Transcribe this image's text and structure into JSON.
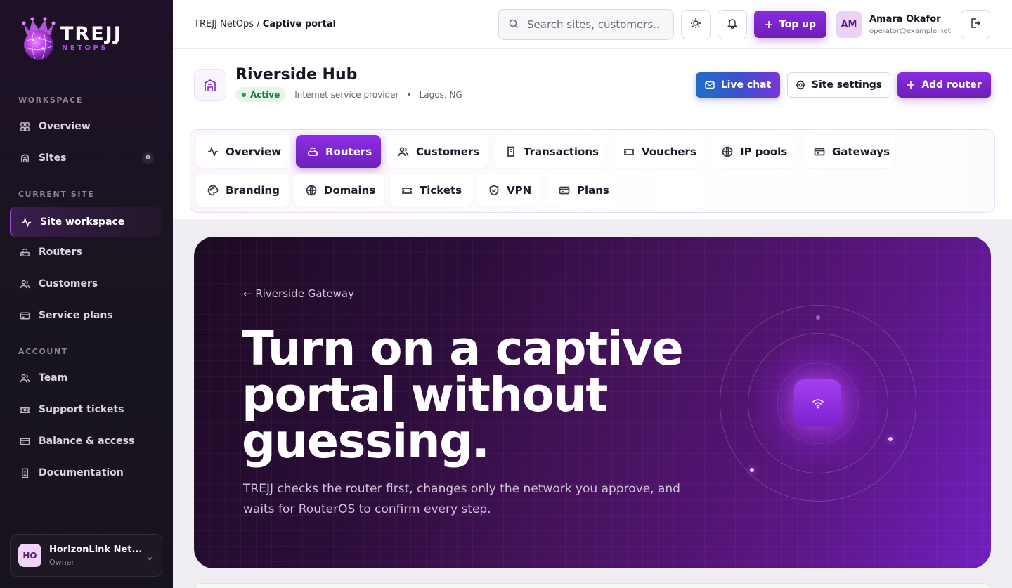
{
  "brand": {
    "title": "TREJJ",
    "subtitle": "NETOPS",
    "accent": "#7c22ce"
  },
  "sidebar": {
    "sections": {
      "workspace": "WORKSPACE",
      "current_site": "CURRENT SITE",
      "account": "ACCOUNT"
    },
    "items": [
      {
        "label": "Overview",
        "icon": "grid-icon"
      },
      {
        "label": "Sites",
        "icon": "building-icon",
        "badge": "0"
      },
      {
        "label": "Site workspace",
        "icon": "activity-icon",
        "active": true
      },
      {
        "label": "Routers",
        "icon": "router-icon"
      },
      {
        "label": "Customers",
        "icon": "users-icon"
      },
      {
        "label": "Service plans",
        "icon": "card-icon"
      },
      {
        "label": "Team",
        "icon": "users-icon"
      },
      {
        "label": "Support tickets",
        "icon": "ticket-icon"
      },
      {
        "label": "Balance & access",
        "icon": "card-icon"
      },
      {
        "label": "Documentation",
        "icon": "doc-icon"
      }
    ],
    "org": {
      "initials": "HO",
      "name": "HorizonLink Net...",
      "role": "Owner"
    }
  },
  "topbar": {
    "breadcrumb_root": "TREJJ NetOps",
    "breadcrumb_sep": "/",
    "breadcrumb_current": "Captive portal",
    "search_placeholder": "Search sites, customers...",
    "topup_label": "Top up",
    "user": {
      "initials": "AM",
      "name": "Amara Okafor",
      "email": "operator@example.net"
    }
  },
  "site": {
    "name": "Riverside Hub",
    "status": "Active",
    "type": "Internet service provider",
    "dot": "•",
    "location": "Lagos, NG",
    "buttons": {
      "live_chat": "Live chat",
      "settings": "Site settings",
      "add_router": "Add router"
    }
  },
  "tabs": [
    {
      "label": "Overview",
      "icon": "activity-icon"
    },
    {
      "label": "Routers",
      "icon": "router-icon",
      "active": true
    },
    {
      "label": "Customers",
      "icon": "users-icon"
    },
    {
      "label": "Transactions",
      "icon": "receipt-icon"
    },
    {
      "label": "Vouchers",
      "icon": "ticket-icon"
    },
    {
      "label": "IP pools",
      "icon": "globe-icon"
    },
    {
      "label": "Gateways",
      "icon": "card-icon"
    },
    {
      "label": "Branding",
      "icon": "palette-icon"
    },
    {
      "label": "Domains",
      "icon": "globe-icon"
    },
    {
      "label": "Tickets",
      "icon": "ticket-icon"
    },
    {
      "label": "VPN",
      "icon": "shield-icon"
    },
    {
      "label": "Plans",
      "icon": "card-icon"
    }
  ],
  "hero": {
    "back_link": "← Riverside Gateway",
    "title": "Turn on a captive portal without guessing.",
    "text": "TREJJ checks the router first, changes only the network you approve, and waits for RouterOS to confirm every step."
  }
}
